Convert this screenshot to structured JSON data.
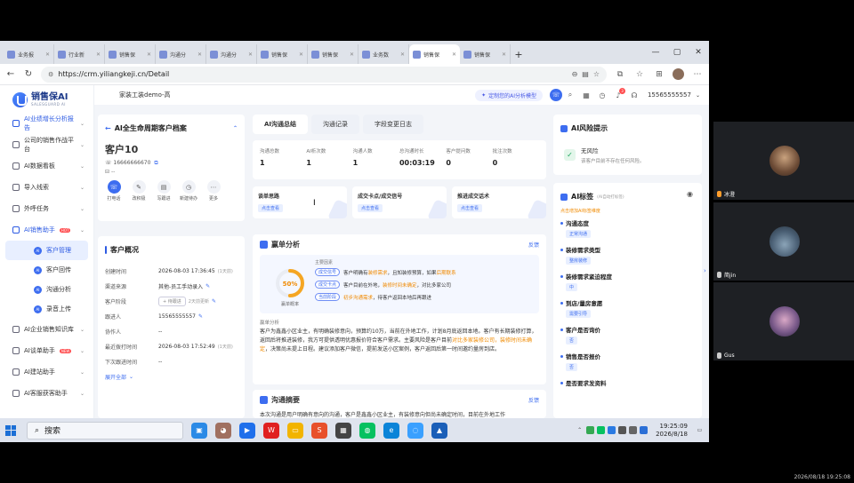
{
  "browser": {
    "tabs": [
      {
        "label": "业务报"
      },
      {
        "label": "行业新"
      },
      {
        "label": "销售保"
      },
      {
        "label": "沟通分"
      },
      {
        "label": "沟通分"
      },
      {
        "label": "销售保"
      },
      {
        "label": "销售保"
      },
      {
        "label": "业务数"
      },
      {
        "label": "销售保",
        "active": true
      },
      {
        "label": "销售保"
      }
    ],
    "new_tab": "+",
    "url": "https://crm.yiliangkeji.cn/Detail"
  },
  "sidebar": {
    "brand": "销售保AI",
    "brand_sub": "SALESGUARD AI",
    "items": [
      {
        "label": "AI业绩增长分析报告",
        "accent": true
      },
      {
        "label": "公司的销售作战平台"
      },
      {
        "label": "AI数据看板"
      },
      {
        "label": "导入线索"
      },
      {
        "label": "外呼任务"
      },
      {
        "label": "AI销售助手",
        "badge": "HOT",
        "accent": true
      }
    ],
    "subitems": [
      {
        "label": "客户管理",
        "active": true
      },
      {
        "label": "客户回传"
      },
      {
        "label": "沟通分析"
      },
      {
        "label": "录音上传"
      }
    ],
    "items2": [
      {
        "label": "AI企业销售知识库"
      },
      {
        "label": "AI谈单助手",
        "badge": "NEW"
      },
      {
        "label": "AI建站助手"
      },
      {
        "label": "AI客服获客助手"
      }
    ]
  },
  "header": {
    "company": "家装工装demo-高",
    "custom_model": "定制您的AI分析模型",
    "notif_count": "3",
    "phone": "15565555557"
  },
  "customer": {
    "panel_title": "AI全生命周期客户档案",
    "name": "客户10",
    "phone": "16666666670",
    "dots": "--",
    "actions": [
      {
        "label": "打电话",
        "icon": "phone-icon"
      },
      {
        "label": "改积极",
        "icon": "edit-icon"
      },
      {
        "label": "写跟进",
        "icon": "note-icon"
      },
      {
        "label": "新建待办",
        "icon": "clock-icon"
      },
      {
        "label": "更多",
        "icon": "more-icon"
      }
    ]
  },
  "overview": {
    "title": "客户概况",
    "rows": [
      {
        "k": "创建时间",
        "v": "2026-08-03 17:36:45",
        "g": "(1天前)"
      },
      {
        "k": "渠道来源",
        "v": "其他-员工手动录入",
        "pen": true
      },
      {
        "k": "客户阶段",
        "tag": "+ 待跟进",
        "g": "2天前更新",
        "pen": true
      },
      {
        "k": "跟进人",
        "v": "15565555557",
        "pen": true
      },
      {
        "k": "协作人",
        "v": "--"
      },
      {
        "k": "最近拨打时间",
        "v": "2026-08-03 17:52:49",
        "g": "(1天前)"
      },
      {
        "k": "下次跟进时间",
        "v": "--"
      }
    ],
    "expand": "展开全部"
  },
  "tabs": [
    "AI沟通总结",
    "沟通记录",
    "字段变更日志"
  ],
  "stats": [
    {
      "l": "沟通总数",
      "n": "1"
    },
    {
      "l": "AI析次数",
      "n": "1"
    },
    {
      "l": "沟通人数",
      "n": "1"
    },
    {
      "l": "总沟通时长",
      "n": "00:03:19"
    },
    {
      "l": "客户提问数",
      "n": "0"
    },
    {
      "l": "批注次数",
      "n": "0"
    }
  ],
  "cards": [
    {
      "t": "谈单思路",
      "b": "点击查看"
    },
    {
      "t": "成交卡点/成交信号",
      "b": "点击查看"
    },
    {
      "t": "推进成交话术",
      "b": "点击查看"
    }
  ],
  "win": {
    "title": "赢单分析",
    "feedback": "反馈",
    "percent": 50,
    "percent_label": "50%",
    "ring_label": "赢单概率",
    "main_factors": "主要因素",
    "factors": [
      {
        "tag": "成交信号",
        "pre": "客户明确有",
        "hl": "装修需求",
        "post": "，且知装修预算，如果",
        "hl2": "后期联系"
      },
      {
        "tag": "成交卡点",
        "pre": "客户目前在外地，",
        "hl": "装修时间未确定",
        "post": "，对比多家公司"
      },
      {
        "tag": "当前阶段",
        "pre": "",
        "hl": "初步沟通需求",
        "post": "，待客户返回本地后再跟进"
      }
    ],
    "reason_label": "赢单分析",
    "reason_a": "客户为鑫鑫小区业主，有明确装修意向，预算约10万，当前在外地工作，计划8月底返回本地。客户有长期装修打算，返回后将推进装修，我方可提供透明优惠报价符合客户需求。主要风险是客户目前",
    "reason_hl": "对比多家装修公司，装修时间未确定",
    "reason_b": "，决策尚未提上日程。建议添加客户微信，提前发送小区案例，客户返回后第一时间邀约量房到店。"
  },
  "summary": {
    "title": "沟通摘要",
    "feedback": "反馈",
    "text": "本次沟通是用户明确有意向的沟通，客户是鑫鑫小区业主，有装修意向但尚未确定时间，目前在外地工作"
  },
  "risk": {
    "title": "AI风险提示",
    "status": "无风险",
    "desc": "该客户目前不存在任何风险。"
  },
  "labels": {
    "title": "AI标签",
    "title_sub": "(AI自动打标签)",
    "hint": "点击增加AI标签维度",
    "rows": [
      {
        "h": "沟通态度",
        "tag": "正常沟通"
      },
      {
        "h": "装修需求类型",
        "tag": "整房装修"
      },
      {
        "h": "装修需求紧迫程度",
        "tag": "中"
      },
      {
        "h": "到店/量房意愿",
        "tag": "需要引导"
      },
      {
        "h": "客户是否询价",
        "tag": "否"
      },
      {
        "h": "销售是否报价",
        "tag": "否"
      },
      {
        "h": "是否要求发资料",
        "tag": ""
      }
    ]
  },
  "taskbar": {
    "search": "搜索",
    "time": "19:25:09",
    "date": "2026/8/18"
  },
  "meeting": {
    "p1": "冰澄",
    "p2": "简jin",
    "p3": "Gus",
    "stamp": "2026/08/18 19:25:08"
  }
}
